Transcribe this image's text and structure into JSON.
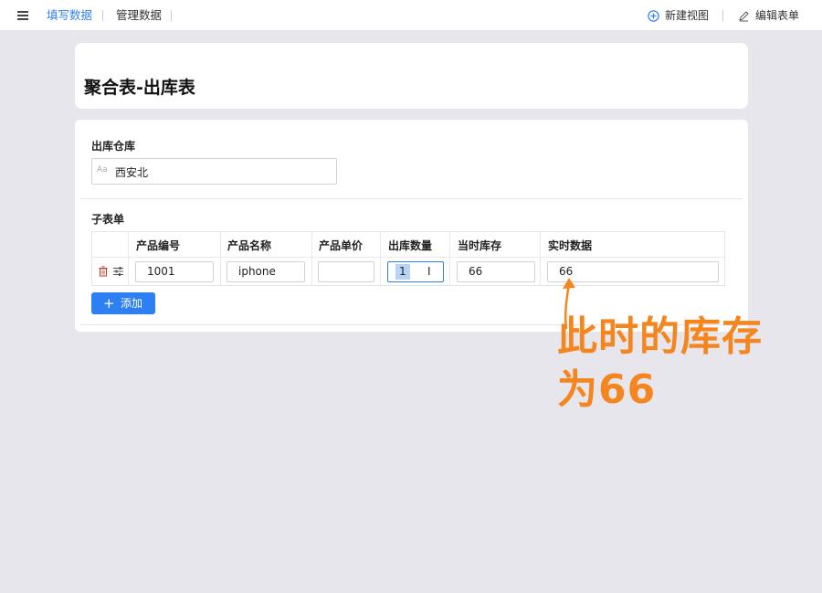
{
  "topbar": {
    "tabs": [
      {
        "label": "填写数据",
        "active": true
      },
      {
        "label": "管理数据",
        "active": false
      }
    ],
    "actions": {
      "new_view": "新建视图",
      "edit_form": "编辑表单"
    }
  },
  "form": {
    "title": "聚合表-出库表",
    "warehouse": {
      "label": "出库仓库",
      "value": "西安北",
      "type_hint": "Aa"
    },
    "subform": {
      "label": "子表单",
      "columns": [
        "产品编号",
        "产品名称",
        "产品单价",
        "出库数量",
        "当时库存",
        "实时数据"
      ],
      "rows": [
        {
          "product_code": "1001",
          "product_name": "iphone",
          "unit_price": "",
          "out_qty": "1",
          "stock_then": "66",
          "realtime": "66"
        }
      ],
      "add_label": "添加"
    }
  },
  "annotation": {
    "line1": "此时的库存",
    "line2": "为66",
    "color": "#f5861f"
  },
  "colors": {
    "accent": "#2d7ff2",
    "delete_icon": "#c0392b"
  }
}
